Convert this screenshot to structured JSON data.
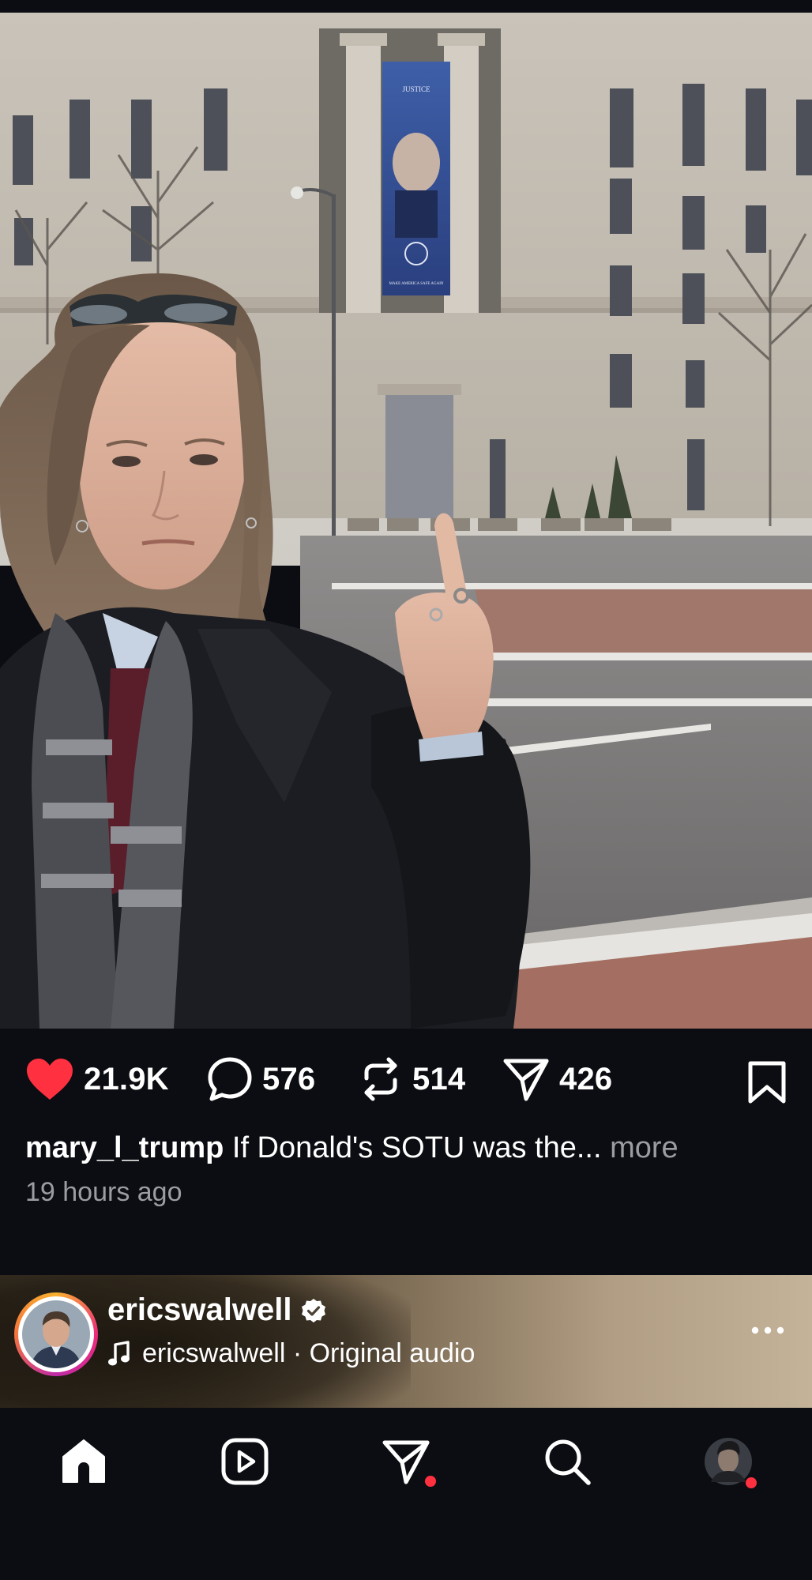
{
  "post": {
    "likes": "21.9K",
    "comments": "576",
    "reposts": "514",
    "shares": "426",
    "username": "mary_l_trump",
    "caption_text": " If Donald's SOTU was the...",
    "more_label": " more",
    "time_ago": "19 hours ago",
    "banner_text_top": "JUSTICE",
    "banner_text_bottom": "MAKE AMERICA SAFE AGAIN"
  },
  "next_post": {
    "username": "ericswalwell",
    "audio_label": "ericswalwell · Original audio",
    "verified": true
  },
  "nav": {
    "items": [
      "home-icon",
      "reels-icon",
      "direct-messages-icon",
      "search-icon",
      "profile-avatar"
    ],
    "active": "home"
  },
  "colors": {
    "background": "#0c0d12",
    "like_red": "#ff3040",
    "secondary_text": "#9b9ca4"
  }
}
